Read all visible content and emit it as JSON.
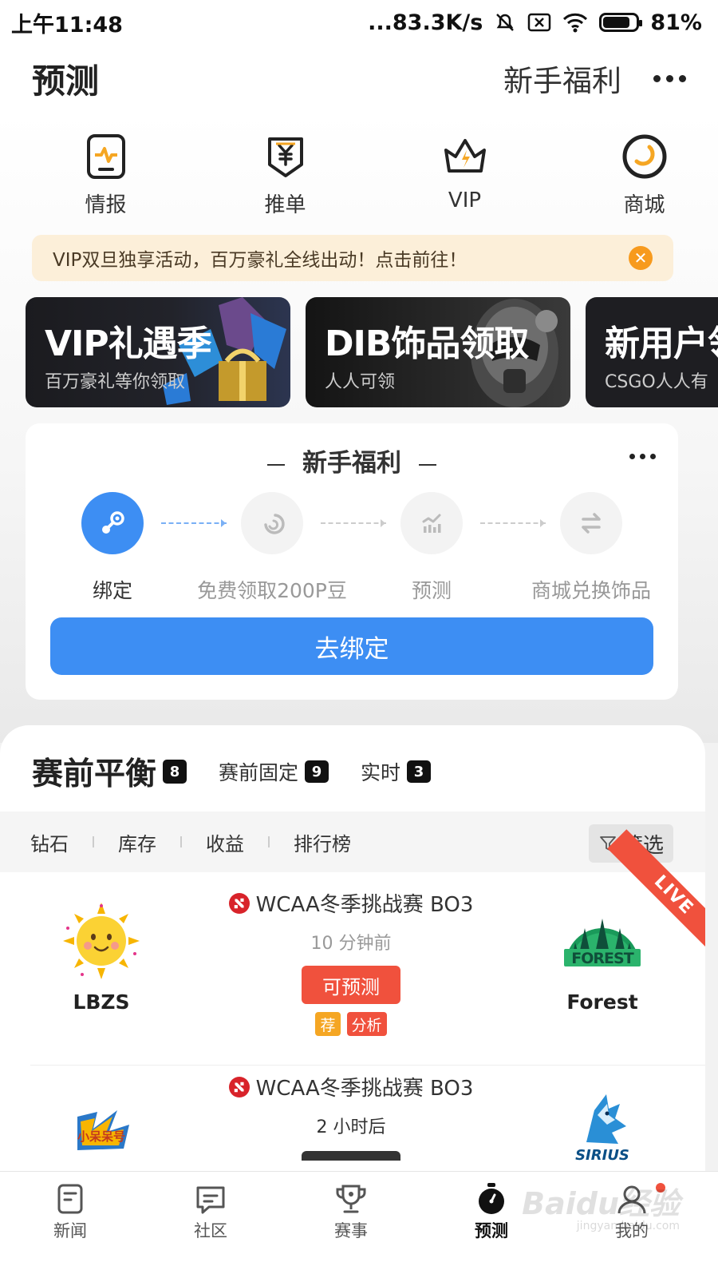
{
  "status_bar": {
    "time": "上午11:48",
    "network_speed": "...83.3K/s",
    "battery": "81%",
    "battery_level": 0.81
  },
  "header": {
    "title": "预测",
    "newbie_link": "新手福利"
  },
  "quick_nav": [
    {
      "label": "情报",
      "icon": "news-report-icon"
    },
    {
      "label": "推单",
      "icon": "yuan-shield-icon"
    },
    {
      "label": "VIP",
      "icon": "crown-icon"
    },
    {
      "label": "商城",
      "icon": "mall-icon"
    }
  ],
  "notice": {
    "text": "VIP双旦独享活动，百万豪礼全线出动！点击前往！"
  },
  "banners": [
    {
      "title": "VIP礼遇季",
      "subtitle": "百万豪礼等你领取"
    },
    {
      "title": "DIB饰品领取",
      "subtitle": "人人可领"
    },
    {
      "title": "新用户领",
      "subtitle": "CSGO人人有"
    }
  ],
  "newbie": {
    "title": "新手福利",
    "steps": [
      {
        "label": "绑定",
        "icon": "steam-icon"
      },
      {
        "label": "免费领取200P豆",
        "icon": "bean-icon"
      },
      {
        "label": "预测",
        "icon": "chart-icon"
      },
      {
        "label": "商城兑换饰品",
        "icon": "exchange-icon"
      }
    ],
    "active_step": 1,
    "button": "去绑定"
  },
  "tabs": [
    {
      "label": "赛前平衡",
      "count": "8"
    },
    {
      "label": "赛前固定",
      "count": "9"
    },
    {
      "label": "实时",
      "count": "3"
    }
  ],
  "filters": {
    "items": [
      "钻石",
      "库存",
      "收益",
      "排行榜"
    ],
    "button": "筛选"
  },
  "matches": [
    {
      "title": "WCAA冬季挑战赛 BO3",
      "time": "10 分钟前",
      "team_left": "LBZS",
      "team_right": "Forest",
      "action": "可预测",
      "tags": [
        "荐",
        "分析"
      ],
      "live_label": "LIVE"
    },
    {
      "title": "WCAA冬季挑战赛 BO3",
      "time": "2 小时后",
      "team_left_logo_text": "小呆呆号",
      "team_right_logo_text": "SIRIUS"
    }
  ],
  "bottom_nav": [
    {
      "label": "新闻",
      "icon": "news-icon"
    },
    {
      "label": "社区",
      "icon": "community-icon"
    },
    {
      "label": "赛事",
      "icon": "trophy-icon"
    },
    {
      "label": "预测",
      "icon": "stopwatch-icon"
    },
    {
      "label": "我的",
      "icon": "profile-icon"
    }
  ],
  "watermark": {
    "text": "Baidu经验",
    "sub": "jingyan.baidu.com"
  },
  "colors": {
    "primary": "#3d8ef3",
    "accent_red": "#f0513d",
    "notice_bg": "#fcefd9",
    "notice_icon": "#f79a1d"
  }
}
